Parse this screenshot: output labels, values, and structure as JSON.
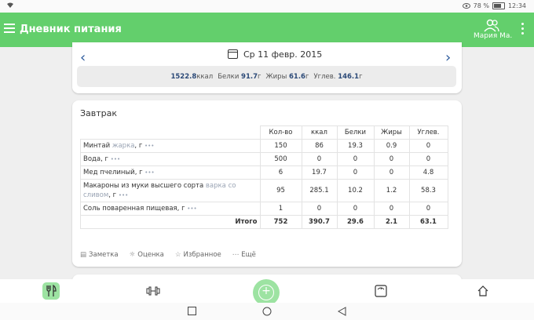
{
  "status_bar": {
    "battery": "78 %",
    "time": "12:34"
  },
  "app_bar": {
    "title": "Дневник питания",
    "user_name": "Мария Ма."
  },
  "date_nav": {
    "date": "Ср 11 февр. 2015"
  },
  "day_summary": {
    "kcal_value": "1522.8",
    "kcal_unit": "ккал",
    "protein_label": "Белки",
    "protein_value": "91.7",
    "protein_unit": "г",
    "fat_label": "Жиры",
    "fat_value": "61.6",
    "fat_unit": "г",
    "carbs_label": "Углев.",
    "carbs_value": "146.1",
    "carbs_unit": "г"
  },
  "meal": {
    "title": "Завтрак",
    "columns": [
      "Кол-во",
      "ккал",
      "Белки",
      "Жиры",
      "Углев."
    ],
    "rows": [
      {
        "name": "Минтай",
        "note": "жарка",
        "unit": ", г",
        "more": "•••",
        "qty": "150",
        "kcal": "86",
        "protein": "19.3",
        "fat": "0.9",
        "carbs": "0"
      },
      {
        "name": "Вода",
        "note": "",
        "unit": ", г",
        "more": "•••",
        "qty": "500",
        "kcal": "0",
        "protein": "0",
        "fat": "0",
        "carbs": "0"
      },
      {
        "name": "Мед пчелиный",
        "note": "",
        "unit": ", г",
        "more": "•••",
        "qty": "6",
        "kcal": "19.7",
        "protein": "0",
        "fat": "0",
        "carbs": "4.8"
      },
      {
        "name": "Макароны из муки высшего сорта",
        "note": "варка со сливом",
        "unit": ", г",
        "more": "•••",
        "qty": "95",
        "kcal": "285.1",
        "protein": "10.2",
        "fat": "1.2",
        "carbs": "58.3"
      },
      {
        "name": "Соль поваренная пищевая",
        "note": "",
        "unit": ", г",
        "more": "•••",
        "qty": "1",
        "kcal": "0",
        "protein": "0",
        "fat": "0",
        "carbs": "0"
      }
    ],
    "total": {
      "label": "Итого",
      "qty": "752",
      "kcal": "390.7",
      "protein": "29.6",
      "fat": "2.1",
      "carbs": "63.1"
    },
    "actions": {
      "note": "Заметка",
      "rating": "Оценка",
      "favorite": "Избранное",
      "more": "Ещё"
    }
  },
  "icons": {
    "wifi": "wifi-icon",
    "menu": "menu-icon",
    "users": "users-icon",
    "more": "more-vert-icon",
    "calendar": "calendar-icon",
    "diary": "fork-knife-icon",
    "dumbbell": "dumbbell-icon",
    "add": "plus-circle-icon",
    "scale": "scale-icon",
    "home": "home-icon"
  },
  "colors": {
    "accent": "#63cf6c",
    "accent_light": "#9de3a2",
    "link": "#2c5a9c"
  }
}
